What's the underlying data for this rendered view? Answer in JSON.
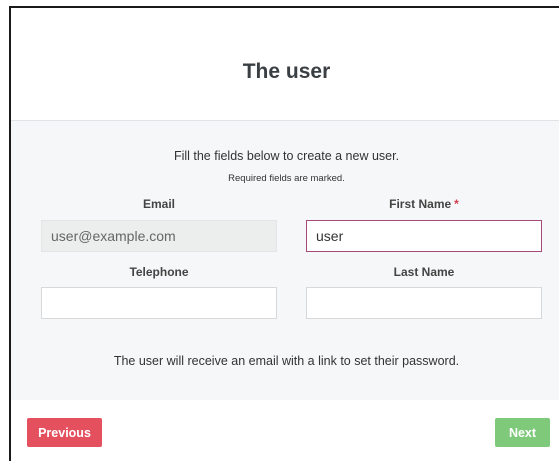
{
  "header": {
    "title": "The user"
  },
  "form": {
    "intro": "Fill the fields below to create a new user.",
    "required_note": "Required fields are marked.",
    "email": {
      "label": "Email",
      "value": "user@example.com",
      "disabled": true
    },
    "first_name": {
      "label": "First Name",
      "required_mark": "*",
      "value": "user"
    },
    "telephone": {
      "label": "Telephone",
      "value": ""
    },
    "last_name": {
      "label": "Last Name",
      "value": ""
    },
    "bottom_note": "The user will receive an email with a link to set their password."
  },
  "footer": {
    "previous_label": "Previous",
    "next_label": "Next"
  },
  "colors": {
    "previous_button": "#e5505f",
    "next_button": "#7fc97a",
    "required_mark": "#d23b4b",
    "focus_border": "#a5487a"
  }
}
